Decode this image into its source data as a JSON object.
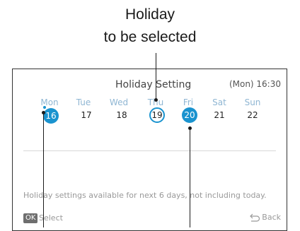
{
  "callout": {
    "line1": "Holiday",
    "line2": "to be selected"
  },
  "screen": {
    "title": "Holiday Setting",
    "datetime": "(Mon) 16:30",
    "weekdays": [
      "Mon",
      "Tue",
      "Wed",
      "Thu",
      "Fri",
      "Sat",
      "Sun"
    ],
    "dates": [
      "16",
      "17",
      "18",
      "19",
      "20",
      "21",
      "22"
    ],
    "today_index": 0,
    "cursor_index": 3,
    "selected_index": 4,
    "note": "Holiday settings available for next 6 days, not including today.",
    "ok_badge": "OK",
    "select_label": "Select",
    "back_label": "Back"
  },
  "colors": {
    "accent": "#1a93cf",
    "weekday_text": "#8fb6d3",
    "muted_text": "#999999"
  },
  "icons": {
    "back": "back-arrow-icon",
    "ok": "ok-button-icon"
  }
}
